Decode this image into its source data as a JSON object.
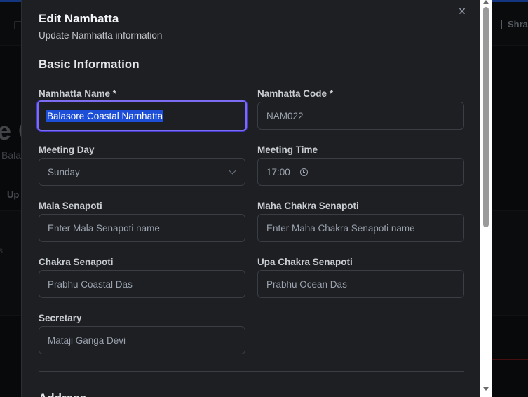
{
  "background": {
    "user_label": "Shra",
    "partial_heading": "e C",
    "partial_subtitle": "Bala",
    "partial_tab": "Up",
    "partial_s": "s"
  },
  "modal": {
    "title": "Edit Namhatta",
    "subtitle": "Update Namhatta information",
    "close_icon": "×",
    "section_basic": "Basic Information",
    "section_next": "Address",
    "fields": {
      "namhatta_name": {
        "label": "Namhatta Name *",
        "value": "Balasore Coastal Namhatta"
      },
      "namhatta_code": {
        "label": "Namhatta Code *",
        "value": "NAM022"
      },
      "meeting_day": {
        "label": "Meeting Day",
        "value": "Sunday"
      },
      "meeting_time": {
        "label": "Meeting Time",
        "value": "17:00"
      },
      "mala_senapoti": {
        "label": "Mala Senapoti",
        "placeholder": "Enter Mala Senapoti name"
      },
      "maha_chakra_senapoti": {
        "label": "Maha Chakra Senapoti",
        "placeholder": "Enter Maha Chakra Senapoti name"
      },
      "chakra_senapoti": {
        "label": "Chakra Senapoti",
        "value": "Prabhu Coastal Das"
      },
      "upa_chakra_senapoti": {
        "label": "Upa Chakra Senapoti",
        "value": "Prabhu Ocean Das"
      },
      "secretary": {
        "label": "Secretary",
        "value": "Mataji Ganga Devi"
      }
    }
  }
}
